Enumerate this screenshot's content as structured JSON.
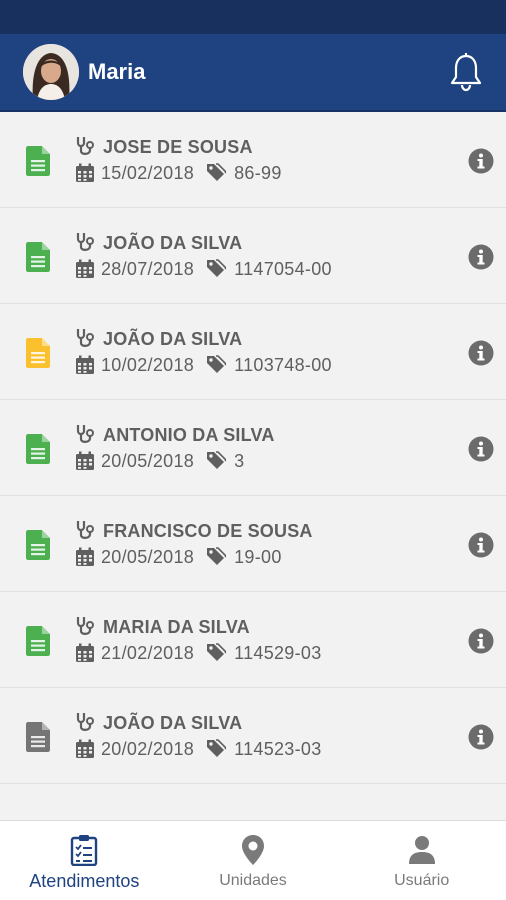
{
  "header": {
    "user_name": "Maria"
  },
  "items": [
    {
      "name": "JOSE DE SOUSA",
      "date": "15/02/2018",
      "code": "86-99",
      "doc_color": "#4caf50"
    },
    {
      "name": "JOÃO DA SILVA",
      "date": "28/07/2018",
      "code": "1147054-00",
      "doc_color": "#4caf50"
    },
    {
      "name": "JOÃO DA SILVA",
      "date": "10/02/2018",
      "code": "1103748-00",
      "doc_color": "#fbc02d"
    },
    {
      "name": "ANTONIO DA SILVA",
      "date": "20/05/2018",
      "code": "3",
      "doc_color": "#4caf50"
    },
    {
      "name": "FRANCISCO DE SOUSA",
      "date": "20/05/2018",
      "code": "19-00",
      "doc_color": "#4caf50"
    },
    {
      "name": "MARIA DA SILVA",
      "date": "21/02/2018",
      "code": "114529-03",
      "doc_color": "#4caf50"
    },
    {
      "name": "JOÃO DA SILVA",
      "date": "20/02/2018",
      "code": "114523-03",
      "doc_color": "#757575"
    }
  ],
  "nav": {
    "atendimentos": "Atendimentos",
    "unidades": "Unidades",
    "usuario": "Usuário"
  },
  "colors": {
    "primary": "#1f4280",
    "statusbar": "#18305e",
    "text": "#5f5f5f"
  }
}
